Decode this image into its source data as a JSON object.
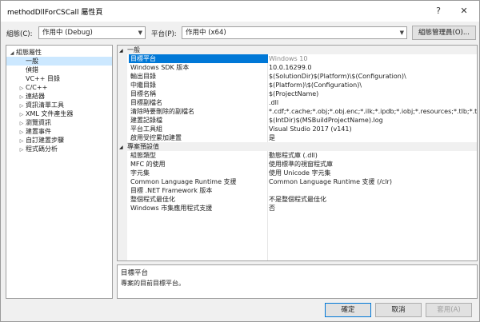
{
  "window": {
    "title": "methodDllForCSCall 屬性頁",
    "help": "?",
    "close": "✕"
  },
  "config": {
    "config_label": "組態(C):",
    "config_value": "作用中 (Debug)",
    "platform_label": "平台(P):",
    "platform_value": "作用中 (x64)",
    "manager_label": "組態管理員(O)..."
  },
  "tree": [
    {
      "label": "組態屬性",
      "twisty": "◢",
      "indent": 0
    },
    {
      "label": "一般",
      "twisty": "",
      "indent": 1,
      "selected": true
    },
    {
      "label": "偵錯",
      "twisty": "",
      "indent": 1
    },
    {
      "label": "VC++ 目錄",
      "twisty": "",
      "indent": 1
    },
    {
      "label": "C/C++",
      "twisty": "▷",
      "indent": 1
    },
    {
      "label": "連結器",
      "twisty": "▷",
      "indent": 1
    },
    {
      "label": "資訊清單工具",
      "twisty": "▷",
      "indent": 1
    },
    {
      "label": "XML 文件產生器",
      "twisty": "▷",
      "indent": 1
    },
    {
      "label": "瀏覽資訊",
      "twisty": "▷",
      "indent": 1
    },
    {
      "label": "建置事件",
      "twisty": "▷",
      "indent": 1
    },
    {
      "label": "自訂建置步驟",
      "twisty": "▷",
      "indent": 1
    },
    {
      "label": "程式碼分析",
      "twisty": "▷",
      "indent": 1
    }
  ],
  "grid": {
    "categories": [
      {
        "name": "一般",
        "rows": [
          {
            "key": "目標平台",
            "value": "Windows 10",
            "selected": true
          },
          {
            "key": "Windows SDK 版本",
            "value": "10.0.16299.0"
          },
          {
            "key": "輸出目錄",
            "value": "$(SolutionDir)$(Platform)\\$(Configuration)\\"
          },
          {
            "key": "中繼目錄",
            "value": "$(Platform)\\$(Configuration)\\"
          },
          {
            "key": "目標名稱",
            "value": "$(ProjectName)"
          },
          {
            "key": "目標副檔名",
            "value": ".dll"
          },
          {
            "key": "清除時要刪除的副檔名",
            "value": "*.cdf;*.cache;*.obj;*.obj.enc;*.ilk;*.ipdb;*.iobj;*.resources;*.tlb;*.tli;*.t"
          },
          {
            "key": "建置記錄檔",
            "value": "$(IntDir)$(MSBuildProjectName).log"
          },
          {
            "key": "平台工具組",
            "value": "Visual Studio 2017 (v141)"
          },
          {
            "key": "啟用受控累加建置",
            "value": "是"
          }
        ]
      },
      {
        "name": "專案預設值",
        "rows": [
          {
            "key": "組態類型",
            "value": "動態程式庫 (.dll)"
          },
          {
            "key": "MFC 的使用",
            "value": "使用標準的視窗程式庫"
          },
          {
            "key": "字元集",
            "value": "使用 Unicode 字元集"
          },
          {
            "key": "Common Language Runtime 支援",
            "value": "Common Language Runtime 支援 (/clr)"
          },
          {
            "key": "目標 .NET Framework 版本",
            "value": ""
          },
          {
            "key": "整個程式最佳化",
            "value": "不是整個程式最佳化"
          },
          {
            "key": "Windows 市集應用程式支援",
            "value": "否"
          }
        ]
      }
    ],
    "collapse_glyph": "◢"
  },
  "description": {
    "title": "目標平台",
    "text": "專案的目前目標平台。"
  },
  "buttons": {
    "ok": "確定",
    "cancel": "取消",
    "apply": "套用(A)"
  }
}
